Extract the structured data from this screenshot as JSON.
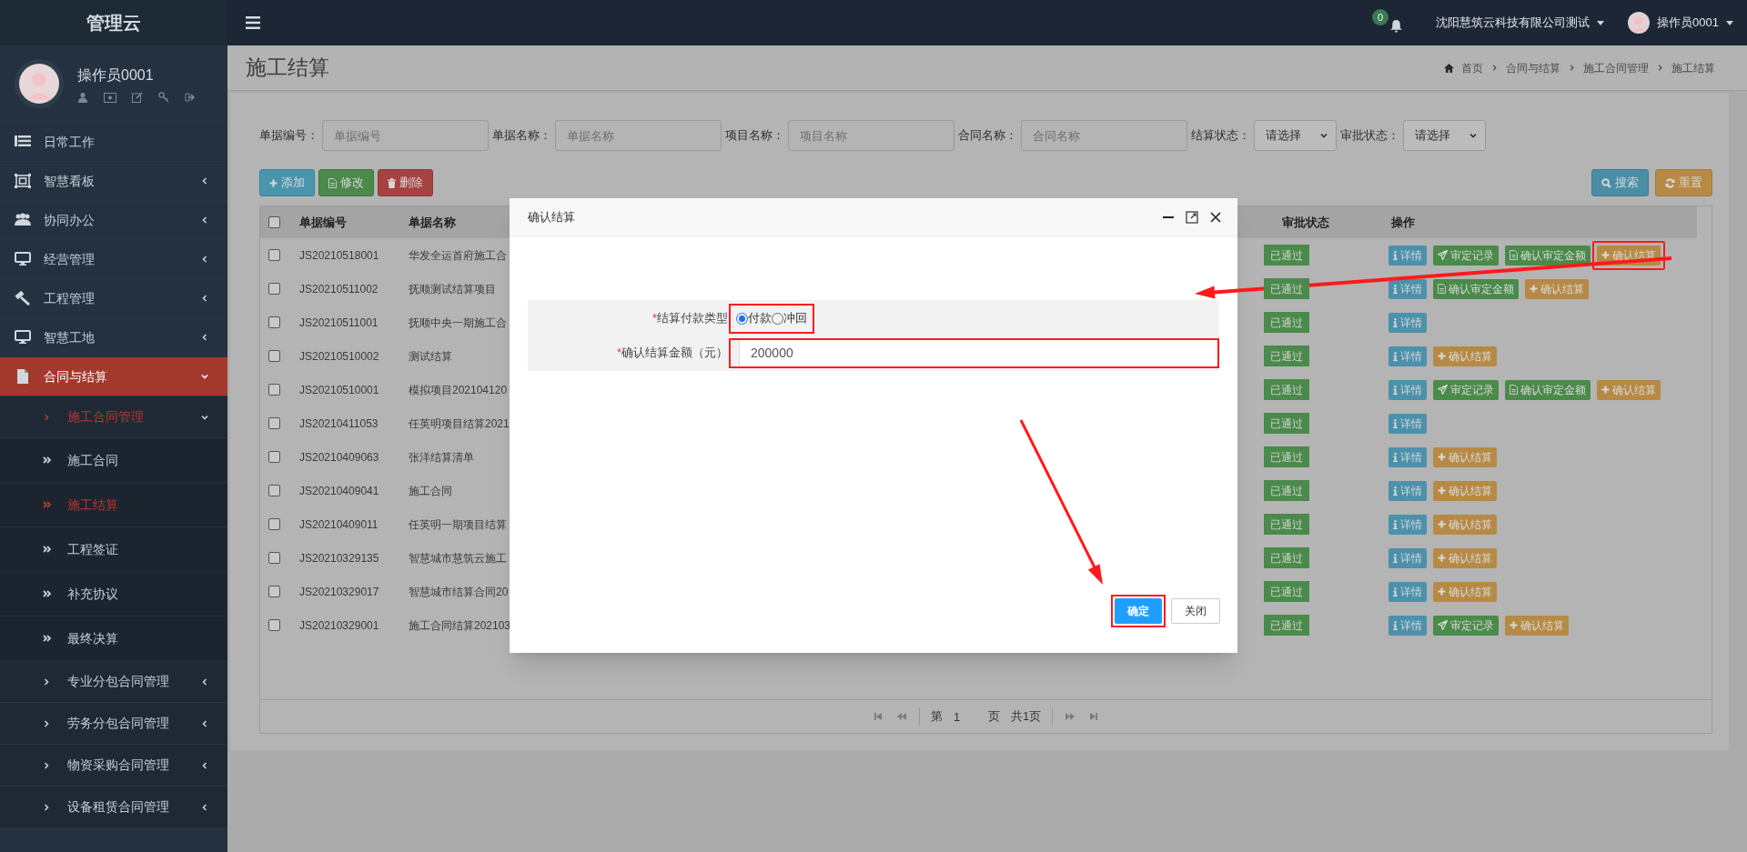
{
  "brand": "管理云",
  "user_panel": {
    "name": "操作员0001"
  },
  "sidebar": {
    "items": [
      {
        "label": "日常工作",
        "selected": false
      },
      {
        "label": "智慧看板",
        "has_submenu": true,
        "expanded": false,
        "selected": false
      },
      {
        "label": "协同办公",
        "has_submenu": true,
        "expanded": false,
        "selected": false
      },
      {
        "label": "经营管理",
        "has_submenu": true,
        "expanded": false,
        "selected": false
      },
      {
        "label": "工程管理",
        "has_submenu": true,
        "expanded": false,
        "selected": false
      },
      {
        "label": "智慧工地",
        "has_submenu": true,
        "expanded": false,
        "selected": false
      },
      {
        "label": "合同与结算",
        "has_submenu": true,
        "expanded": true,
        "selected": true,
        "children": [
          {
            "label": "施工合同管理",
            "has_submenu": true,
            "expanded": true,
            "selected": true,
            "children": [
              {
                "label": "施工合同",
                "selected": false
              },
              {
                "label": "施工结算",
                "selected": true
              },
              {
                "label": "工程签证",
                "selected": false
              },
              {
                "label": "补充协议",
                "selected": false
              },
              {
                "label": "最终决算",
                "selected": false
              }
            ]
          },
          {
            "label": "专业分包合同管理",
            "has_submenu": true,
            "expanded": false,
            "selected": false
          },
          {
            "label": "劳务分包合同管理",
            "has_submenu": true,
            "expanded": false,
            "selected": false
          },
          {
            "label": "物资采购合同管理",
            "has_submenu": true,
            "expanded": false,
            "selected": false
          },
          {
            "label": "设备租赁合同管理",
            "has_submenu": true,
            "expanded": false,
            "selected": false
          }
        ]
      }
    ]
  },
  "topbar": {
    "notification_count": "0",
    "company": "沈阳慧筑云科技有限公司测试",
    "user": "操作员0001"
  },
  "page_title": "施工结算",
  "breadcrumb": [
    "首页",
    "合同与结算",
    "施工合同管理",
    "施工结算"
  ],
  "filters": [
    {
      "kind": "text",
      "label": "单据编号：",
      "placeholder": "单据编号"
    },
    {
      "kind": "text",
      "label": "单据名称：",
      "placeholder": "单据名称"
    },
    {
      "kind": "text",
      "label": "项目名称：",
      "placeholder": "项目名称"
    },
    {
      "kind": "text",
      "label": "合同名称：",
      "placeholder": "合同名称"
    },
    {
      "kind": "select",
      "label": "结算状态：",
      "value": "请选择"
    },
    {
      "kind": "select",
      "label": "审批状态：",
      "value": "请选择"
    }
  ],
  "toolbar": {
    "left": [
      {
        "kind": "add",
        "label": "添加"
      },
      {
        "kind": "edit",
        "label": "修改"
      },
      {
        "kind": "delete",
        "label": "删除"
      }
    ],
    "right": [
      {
        "kind": "search",
        "label": "搜索"
      },
      {
        "kind": "reset",
        "label": "重置"
      }
    ]
  },
  "table": {
    "all_selected": false,
    "columns": [
      "单据编号",
      "单据名称",
      "审批状态",
      "操作"
    ],
    "rows": [
      {
        "selected": false,
        "number": "JS20210518001",
        "name": "华发全运首府施工合",
        "status": "已通过",
        "actions": [
          {
            "kind": "detail",
            "label": "详情",
            "highlighted": false
          },
          {
            "kind": "record",
            "label": "审定记录",
            "highlighted": false
          },
          {
            "kind": "amount",
            "label": "确认审定金额",
            "highlighted": false
          },
          {
            "kind": "settle",
            "label": "确认结算",
            "highlighted": true
          }
        ]
      },
      {
        "selected": false,
        "number": "JS20210511002",
        "name": "抚顺测试结算项目",
        "status": "已通过",
        "actions": [
          {
            "kind": "detail",
            "label": "详情",
            "highlighted": false
          },
          {
            "kind": "amount",
            "label": "确认审定金额",
            "highlighted": false
          },
          {
            "kind": "settle",
            "label": "确认结算",
            "highlighted": false
          }
        ]
      },
      {
        "selected": false,
        "number": "JS20210511001",
        "name": "抚顺中央一期施工合",
        "status": "已通过",
        "actions": [
          {
            "kind": "detail",
            "label": "详情",
            "highlighted": false
          }
        ]
      },
      {
        "selected": false,
        "number": "JS20210510002",
        "name": "测试结算",
        "status": "已通过",
        "actions": [
          {
            "kind": "detail",
            "label": "详情",
            "highlighted": false
          },
          {
            "kind": "settle",
            "label": "确认结算",
            "highlighted": false
          }
        ]
      },
      {
        "selected": false,
        "number": "JS20210510001",
        "name": "模拟项目202104120",
        "status": "已通过",
        "actions": [
          {
            "kind": "detail",
            "label": "详情",
            "highlighted": false
          },
          {
            "kind": "record",
            "label": "审定记录",
            "highlighted": false
          },
          {
            "kind": "amount",
            "label": "确认审定金额",
            "highlighted": false
          },
          {
            "kind": "settle",
            "label": "确认结算",
            "highlighted": false
          }
        ]
      },
      {
        "selected": false,
        "number": "JS20210411053",
        "name": "任英明项目结算2021",
        "status": "已通过",
        "actions": [
          {
            "kind": "detail",
            "label": "详情",
            "highlighted": false
          }
        ]
      },
      {
        "selected": false,
        "number": "JS20210409063",
        "name": "张洋结算清单",
        "status": "已通过",
        "actions": [
          {
            "kind": "detail",
            "label": "详情",
            "highlighted": false
          },
          {
            "kind": "settle",
            "label": "确认结算",
            "highlighted": false
          }
        ]
      },
      {
        "selected": false,
        "number": "JS20210409041",
        "name": "施工合同",
        "status": "已通过",
        "actions": [
          {
            "kind": "detail",
            "label": "详情",
            "highlighted": false
          },
          {
            "kind": "settle",
            "label": "确认结算",
            "highlighted": false
          }
        ]
      },
      {
        "selected": false,
        "number": "JS20210409011",
        "name": "任英明一期项目结算",
        "status": "已通过",
        "actions": [
          {
            "kind": "detail",
            "label": "详情",
            "highlighted": false
          },
          {
            "kind": "settle",
            "label": "确认结算",
            "highlighted": false
          }
        ]
      },
      {
        "selected": false,
        "number": "JS20210329135",
        "name": "智慧城市慧筑云施工",
        "status": "已通过",
        "actions": [
          {
            "kind": "detail",
            "label": "详情",
            "highlighted": false
          },
          {
            "kind": "settle",
            "label": "确认结算",
            "highlighted": false
          }
        ]
      },
      {
        "selected": false,
        "number": "JS20210329017",
        "name": "智慧城市结算合同20",
        "status": "已通过",
        "actions": [
          {
            "kind": "detail",
            "label": "详情",
            "highlighted": false
          },
          {
            "kind": "settle",
            "label": "确认结算",
            "highlighted": false
          }
        ]
      },
      {
        "selected": false,
        "number": "JS20210329001",
        "name": "施工合同结算202103",
        "status": "已通过",
        "actions": [
          {
            "kind": "detail",
            "label": "详情",
            "highlighted": false
          },
          {
            "kind": "record",
            "label": "审定记录",
            "highlighted": false
          },
          {
            "kind": "settle",
            "label": "确认结算",
            "highlighted": false
          }
        ]
      }
    ]
  },
  "pagination": {
    "page_prefix": "第",
    "page": "1",
    "page_suffix": "页",
    "total": "共1页"
  },
  "dialog": {
    "title": "确认结算",
    "fields": [
      {
        "kind": "radio",
        "marker": "*",
        "label": "结算付款类型",
        "highlighted": true,
        "options": [
          {
            "label": "付款",
            "selected": true
          },
          {
            "label": "冲回",
            "selected": false
          }
        ]
      },
      {
        "kind": "input",
        "marker": "*",
        "label": "确认结算金额（元）",
        "value": "200000",
        "highlighted": true
      }
    ],
    "buttons": [
      {
        "kind": "primary",
        "label": "确定",
        "highlighted": true
      },
      {
        "kind": "default",
        "label": "关闭",
        "highlighted": false
      }
    ]
  }
}
